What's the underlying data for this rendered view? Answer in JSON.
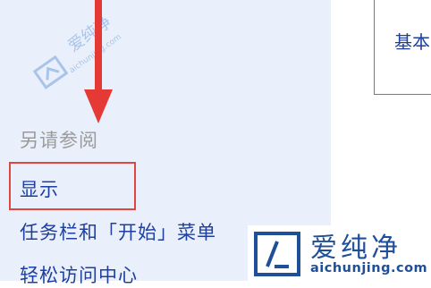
{
  "content_panel": {
    "text": "基本"
  },
  "sidebar": {
    "see_also_heading": "另请参阅",
    "links": [
      {
        "label": "显示",
        "highlighted": true
      },
      {
        "label": "任务栏和「开始」菜单",
        "highlighted": false
      },
      {
        "label": "轻松访问中心",
        "highlighted": false
      }
    ]
  },
  "annotation": {
    "arrow_color": "#e53935",
    "highlight_color": "#e0473f"
  },
  "watermark": {
    "brand": "爱纯净",
    "site": "aichunjing.com",
    "color": "#1e4f98"
  }
}
